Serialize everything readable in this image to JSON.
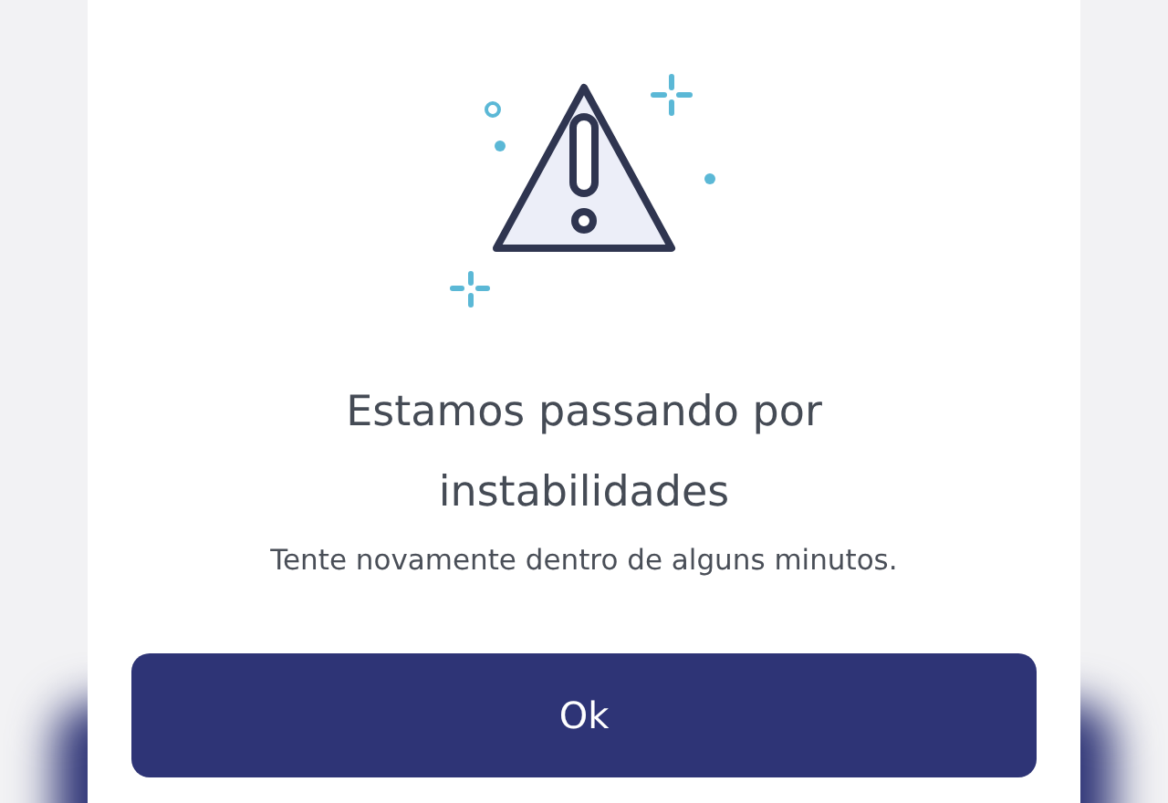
{
  "dialog": {
    "title": "Estamos passando por instabilidades",
    "message": "Tente novamente dentro de alguns minutos.",
    "button": "Ok"
  }
}
